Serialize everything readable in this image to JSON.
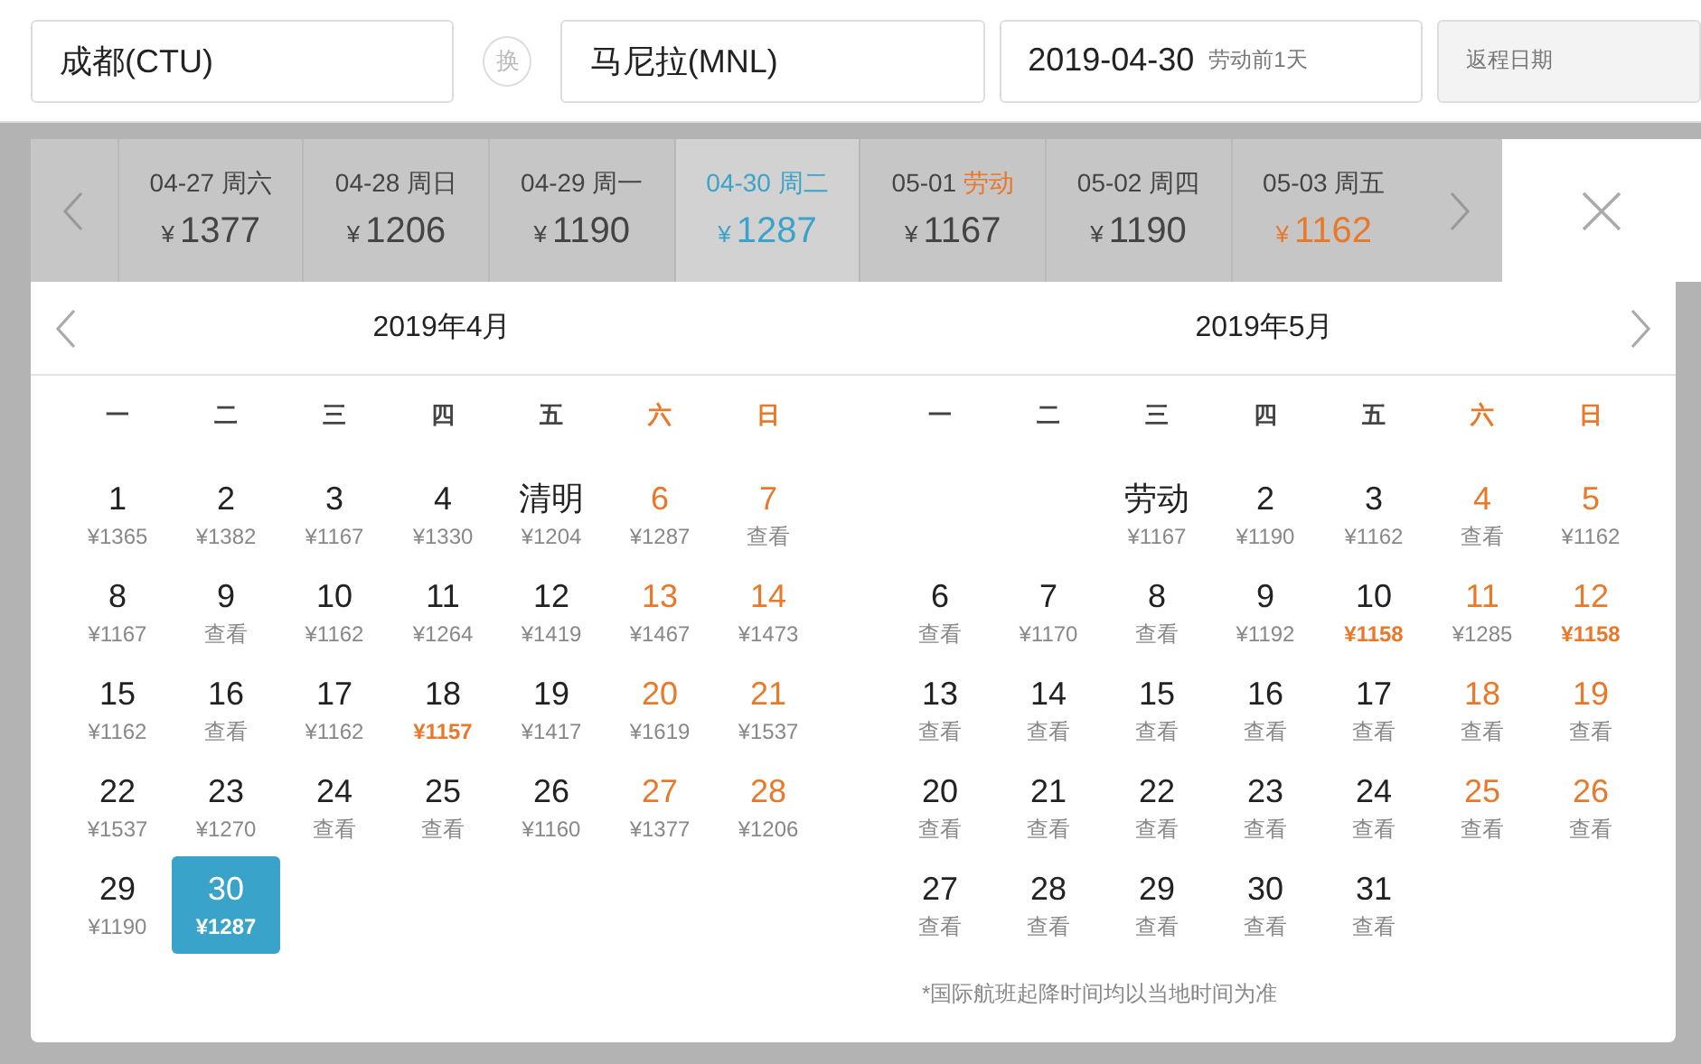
{
  "search": {
    "from": "成都(CTU)",
    "swap": "换",
    "to": "马尼拉(MNL)",
    "depart_date": "2019-04-30",
    "depart_note": "劳动前1天",
    "return_placeholder": "返程日期"
  },
  "date_strip": [
    {
      "date": "04-27",
      "weekday": "周六",
      "price": "1377",
      "selected": false,
      "holiday": false,
      "low_price": false
    },
    {
      "date": "04-28",
      "weekday": "周日",
      "price": "1206",
      "selected": false,
      "holiday": false,
      "low_price": false
    },
    {
      "date": "04-29",
      "weekday": "周一",
      "price": "1190",
      "selected": false,
      "holiday": false,
      "low_price": false
    },
    {
      "date": "04-30",
      "weekday": "周二",
      "price": "1287",
      "selected": true,
      "holiday": false,
      "low_price": false
    },
    {
      "date": "05-01",
      "weekday": "劳动",
      "price": "1167",
      "selected": false,
      "holiday": true,
      "low_price": false
    },
    {
      "date": "05-02",
      "weekday": "周四",
      "price": "1190",
      "selected": false,
      "holiday": false,
      "low_price": false
    },
    {
      "date": "05-03",
      "weekday": "周五",
      "price": "1162",
      "selected": false,
      "holiday": false,
      "low_price": true
    }
  ],
  "currency": "¥",
  "months": [
    {
      "title": "2019年4月",
      "weekdays": [
        {
          "label": "一",
          "weekend": false
        },
        {
          "label": "二",
          "weekend": false
        },
        {
          "label": "三",
          "weekend": false
        },
        {
          "label": "四",
          "weekend": false
        },
        {
          "label": "五",
          "weekend": false
        },
        {
          "label": "六",
          "weekend": true
        },
        {
          "label": "日",
          "weekend": true
        }
      ],
      "days": [
        {
          "kind": "day",
          "day": "1",
          "price": "¥1365",
          "weekend": false,
          "low_price": false,
          "selected": false
        },
        {
          "kind": "day",
          "day": "2",
          "price": "¥1382",
          "weekend": false,
          "low_price": false,
          "selected": false
        },
        {
          "kind": "day",
          "day": "3",
          "price": "¥1167",
          "weekend": false,
          "low_price": false,
          "selected": false
        },
        {
          "kind": "day",
          "day": "4",
          "price": "¥1330",
          "weekend": false,
          "low_price": false,
          "selected": false
        },
        {
          "kind": "day",
          "day": "清明",
          "price": "¥1204",
          "weekend": false,
          "low_price": false,
          "selected": false
        },
        {
          "kind": "day",
          "day": "6",
          "price": "¥1287",
          "weekend": true,
          "low_price": false,
          "selected": false
        },
        {
          "kind": "day",
          "day": "7",
          "price": "查看",
          "weekend": true,
          "low_price": false,
          "selected": false
        },
        {
          "kind": "day",
          "day": "8",
          "price": "¥1167",
          "weekend": false,
          "low_price": false,
          "selected": false
        },
        {
          "kind": "day",
          "day": "9",
          "price": "查看",
          "weekend": false,
          "low_price": false,
          "selected": false
        },
        {
          "kind": "day",
          "day": "10",
          "price": "¥1162",
          "weekend": false,
          "low_price": false,
          "selected": false
        },
        {
          "kind": "day",
          "day": "11",
          "price": "¥1264",
          "weekend": false,
          "low_price": false,
          "selected": false
        },
        {
          "kind": "day",
          "day": "12",
          "price": "¥1419",
          "weekend": false,
          "low_price": false,
          "selected": false
        },
        {
          "kind": "day",
          "day": "13",
          "price": "¥1467",
          "weekend": true,
          "low_price": false,
          "selected": false
        },
        {
          "kind": "day",
          "day": "14",
          "price": "¥1473",
          "weekend": true,
          "low_price": false,
          "selected": false
        },
        {
          "kind": "day",
          "day": "15",
          "price": "¥1162",
          "weekend": false,
          "low_price": false,
          "selected": false
        },
        {
          "kind": "day",
          "day": "16",
          "price": "查看",
          "weekend": false,
          "low_price": false,
          "selected": false
        },
        {
          "kind": "day",
          "day": "17",
          "price": "¥1162",
          "weekend": false,
          "low_price": false,
          "selected": false
        },
        {
          "kind": "day",
          "day": "18",
          "price": "¥1157",
          "weekend": false,
          "low_price": true,
          "selected": false
        },
        {
          "kind": "day",
          "day": "19",
          "price": "¥1417",
          "weekend": false,
          "low_price": false,
          "selected": false
        },
        {
          "kind": "day",
          "day": "20",
          "price": "¥1619",
          "weekend": true,
          "low_price": false,
          "selected": false
        },
        {
          "kind": "day",
          "day": "21",
          "price": "¥1537",
          "weekend": true,
          "low_price": false,
          "selected": false
        },
        {
          "kind": "day",
          "day": "22",
          "price": "¥1537",
          "weekend": false,
          "low_price": false,
          "selected": false
        },
        {
          "kind": "day",
          "day": "23",
          "price": "¥1270",
          "weekend": false,
          "low_price": false,
          "selected": false
        },
        {
          "kind": "day",
          "day": "24",
          "price": "查看",
          "weekend": false,
          "low_price": false,
          "selected": false
        },
        {
          "kind": "day",
          "day": "25",
          "price": "查看",
          "weekend": false,
          "low_price": false,
          "selected": false
        },
        {
          "kind": "day",
          "day": "26",
          "price": "¥1160",
          "weekend": false,
          "low_price": false,
          "selected": false
        },
        {
          "kind": "day",
          "day": "27",
          "price": "¥1377",
          "weekend": true,
          "low_price": false,
          "selected": false
        },
        {
          "kind": "day",
          "day": "28",
          "price": "¥1206",
          "weekend": true,
          "low_price": false,
          "selected": false
        },
        {
          "kind": "day",
          "day": "29",
          "price": "¥1190",
          "weekend": false,
          "low_price": false,
          "selected": false
        },
        {
          "kind": "day",
          "day": "30",
          "price": "¥1287",
          "selected": true
        }
      ]
    },
    {
      "title": "2019年5月",
      "weekdays": [
        {
          "label": "一",
          "weekend": false
        },
        {
          "label": "二",
          "weekend": false
        },
        {
          "label": "三",
          "weekend": false
        },
        {
          "label": "四",
          "weekend": false
        },
        {
          "label": "五",
          "weekend": false
        },
        {
          "label": "六",
          "weekend": true
        },
        {
          "label": "日",
          "weekend": true
        }
      ],
      "days": [
        {
          "kind": "blank"
        },
        {
          "kind": "blank"
        },
        {
          "kind": "day",
          "day": "劳动",
          "price": "¥1167",
          "weekend": false,
          "low_price": false,
          "selected": false
        },
        {
          "kind": "day",
          "day": "2",
          "price": "¥1190",
          "weekend": false,
          "low_price": false,
          "selected": false
        },
        {
          "kind": "day",
          "day": "3",
          "price": "¥1162",
          "weekend": false,
          "low_price": false,
          "selected": false
        },
        {
          "kind": "day",
          "day": "4",
          "price": "查看",
          "weekend": true,
          "low_price": false,
          "selected": false
        },
        {
          "kind": "day",
          "day": "5",
          "price": "¥1162",
          "weekend": true,
          "low_price": false,
          "selected": false
        },
        {
          "kind": "day",
          "day": "6",
          "price": "查看",
          "weekend": false,
          "low_price": false,
          "selected": false
        },
        {
          "kind": "day",
          "day": "7",
          "price": "¥1170",
          "weekend": false,
          "low_price": false,
          "selected": false
        },
        {
          "kind": "day",
          "day": "8",
          "price": "查看",
          "weekend": false,
          "low_price": false,
          "selected": false
        },
        {
          "kind": "day",
          "day": "9",
          "price": "¥1192",
          "weekend": false,
          "low_price": false,
          "selected": false
        },
        {
          "kind": "day",
          "day": "10",
          "price": "¥1158",
          "weekend": false,
          "low_price": true,
          "selected": false
        },
        {
          "kind": "day",
          "day": "11",
          "price": "¥1285",
          "weekend": true,
          "low_price": false,
          "selected": false
        },
        {
          "kind": "day",
          "day": "12",
          "price": "¥1158",
          "weekend": true,
          "low_price": true,
          "selected": false
        },
        {
          "kind": "day",
          "day": "13",
          "price": "查看",
          "weekend": false,
          "low_price": false,
          "selected": false
        },
        {
          "kind": "day",
          "day": "14",
          "price": "查看",
          "weekend": false,
          "low_price": false,
          "selected": false
        },
        {
          "kind": "day",
          "day": "15",
          "price": "查看",
          "weekend": false,
          "low_price": false,
          "selected": false
        },
        {
          "kind": "day",
          "day": "16",
          "price": "查看",
          "weekend": false,
          "low_price": false,
          "selected": false
        },
        {
          "kind": "day",
          "day": "17",
          "price": "查看",
          "weekend": false,
          "low_price": false,
          "selected": false
        },
        {
          "kind": "day",
          "day": "18",
          "price": "查看",
          "weekend": true,
          "low_price": false,
          "selected": false
        },
        {
          "kind": "day",
          "day": "19",
          "price": "查看",
          "weekend": true,
          "low_price": false,
          "selected": false
        },
        {
          "kind": "day",
          "day": "20",
          "price": "查看",
          "weekend": false,
          "low_price": false,
          "selected": false
        },
        {
          "kind": "day",
          "day": "21",
          "price": "查看",
          "weekend": false,
          "low_price": false,
          "selected": false
        },
        {
          "kind": "day",
          "day": "22",
          "price": "查看",
          "weekend": false,
          "low_price": false,
          "selected": false
        },
        {
          "kind": "day",
          "day": "23",
          "price": "查看",
          "weekend": false,
          "low_price": false,
          "selected": false
        },
        {
          "kind": "day",
          "day": "24",
          "price": "查看",
          "weekend": false,
          "low_price": false,
          "selected": false
        },
        {
          "kind": "day",
          "day": "25",
          "price": "查看",
          "weekend": true,
          "low_price": false,
          "selected": false
        },
        {
          "kind": "day",
          "day": "26",
          "price": "查看",
          "weekend": true,
          "low_price": false,
          "selected": false
        },
        {
          "kind": "day",
          "day": "27",
          "price": "查看",
          "weekend": false,
          "low_price": false,
          "selected": false
        },
        {
          "kind": "day",
          "day": "28",
          "price": "查看",
          "weekend": false,
          "low_price": false,
          "selected": false
        },
        {
          "kind": "day",
          "day": "29",
          "price": "查看",
          "weekend": false,
          "low_price": false,
          "selected": false
        },
        {
          "kind": "day",
          "day": "30",
          "price": "查看",
          "weekend": false,
          "low_price": false,
          "selected": false
        },
        {
          "kind": "day",
          "day": "31",
          "price": "查看",
          "weekend": false,
          "low_price": false,
          "selected": false
        }
      ],
      "footnote": "*国际航班起降时间均以当地时间为准"
    }
  ]
}
